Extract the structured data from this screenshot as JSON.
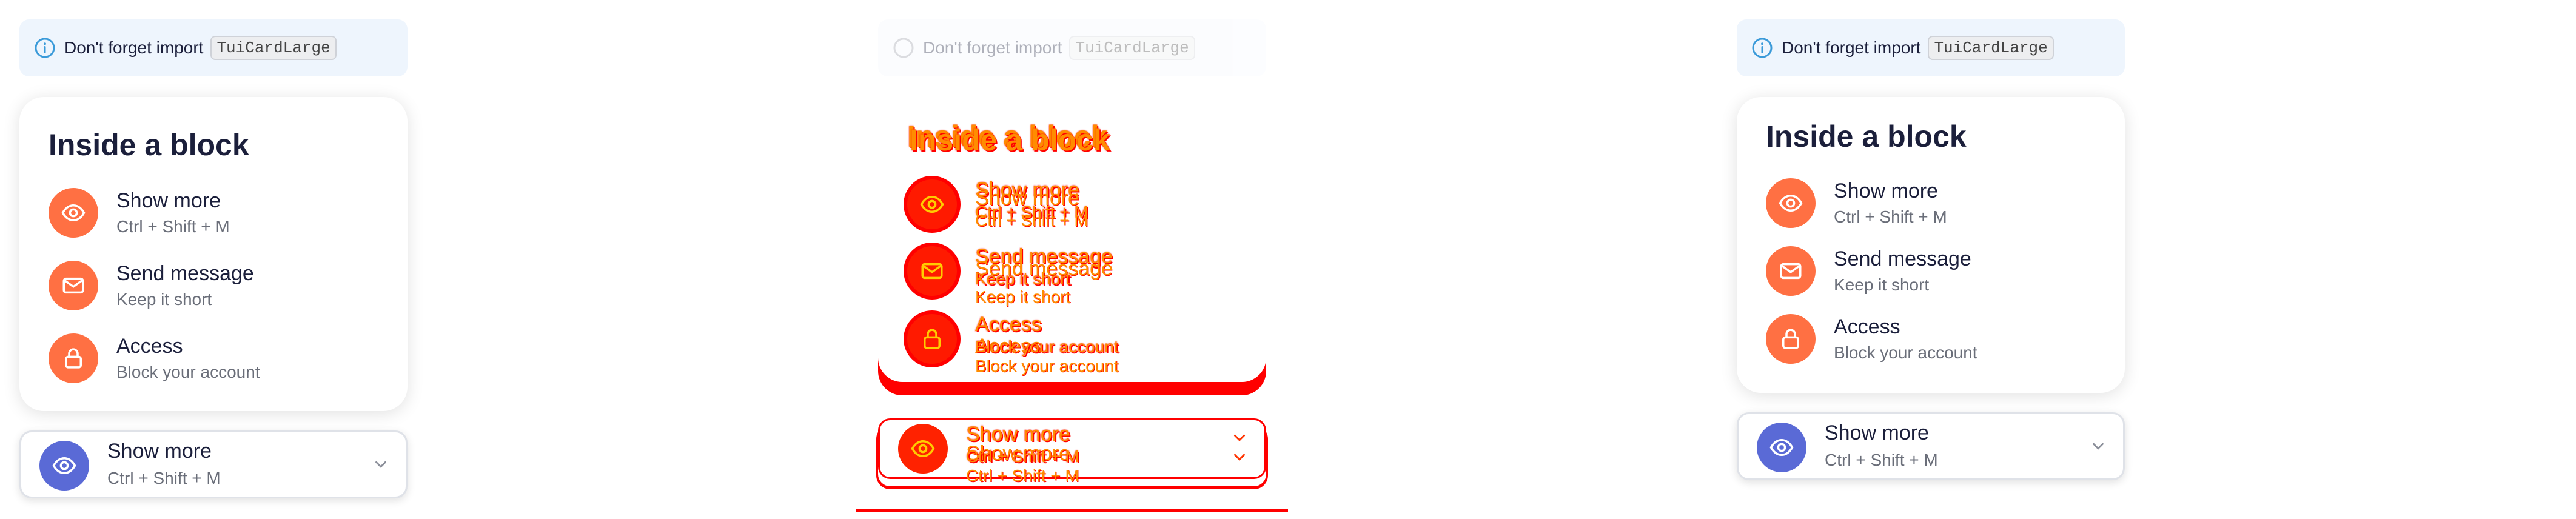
{
  "notice": {
    "text": "Don't forget import",
    "code": "TuiCardLarge"
  },
  "card": {
    "title": "Inside a block",
    "items": [
      {
        "title": "Show more",
        "description": "Ctrl + Shift + M",
        "icon": "eye-icon"
      },
      {
        "title": "Send message",
        "description": "Keep it short",
        "icon": "envelope-icon"
      },
      {
        "title": "Access",
        "description": "Block your account",
        "icon": "lock-icon"
      }
    ]
  },
  "dropdown": {
    "title": "Show more",
    "description": "Ctrl + Shift + M",
    "icon": "eye-icon",
    "toggle_icon": "chevron-down-icon"
  },
  "colors": {
    "accent_orange": "#ff7043",
    "accent_blue": "#5a6ad6",
    "notice_bg": "#eef5fd",
    "info_blue": "#3a9ad9",
    "overlay_red": "#ff0000",
    "overlay_orange": "#ff8c00"
  }
}
